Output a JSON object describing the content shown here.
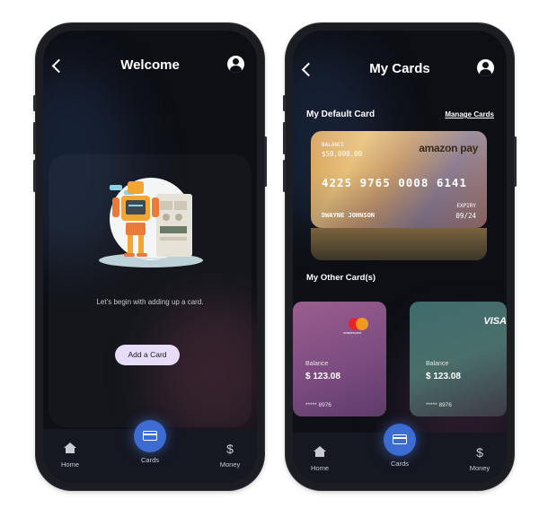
{
  "welcome_screen": {
    "title": "Welcome",
    "message": "Let’s begin with adding up a card.",
    "add_button": "Add a Card",
    "nav": {
      "home": "Home",
      "cards": "Cards",
      "money": "Money"
    }
  },
  "cards_screen": {
    "title": "My Cards",
    "default_section": "My Default Card",
    "manage_link": "Manage Cards",
    "default_card": {
      "balance_label": "BALANCE",
      "balance_value": "$50,000.00",
      "brand": "amazon pay",
      "number": "4225 9765 0008 6141",
      "holder": "DWAYNE JOHNSON",
      "expiry_label": "EXPIRY",
      "expiry_value": "09/24"
    },
    "other_section": "My Other Card(s)",
    "other_cards": [
      {
        "brand": "mastercard",
        "balance_label": "Balance",
        "balance": "$ 123.08",
        "number": "***** 8976"
      },
      {
        "brand": "VISA",
        "balance_label": "Balance",
        "balance": "$ 123.08",
        "number": "***** 8976"
      }
    ],
    "nav": {
      "home": "Home",
      "cards": "Cards",
      "money": "Money"
    }
  },
  "colors": {
    "accent": "#3c6bd1",
    "button_bg": "#e8ddf8",
    "screen_bg": "#0d0f15"
  },
  "icons": [
    "chevron-left-icon",
    "profile-icon",
    "home-icon",
    "card-icon",
    "dollar-icon",
    "robot-illustration",
    "mastercard-logo",
    "visa-logo"
  ]
}
